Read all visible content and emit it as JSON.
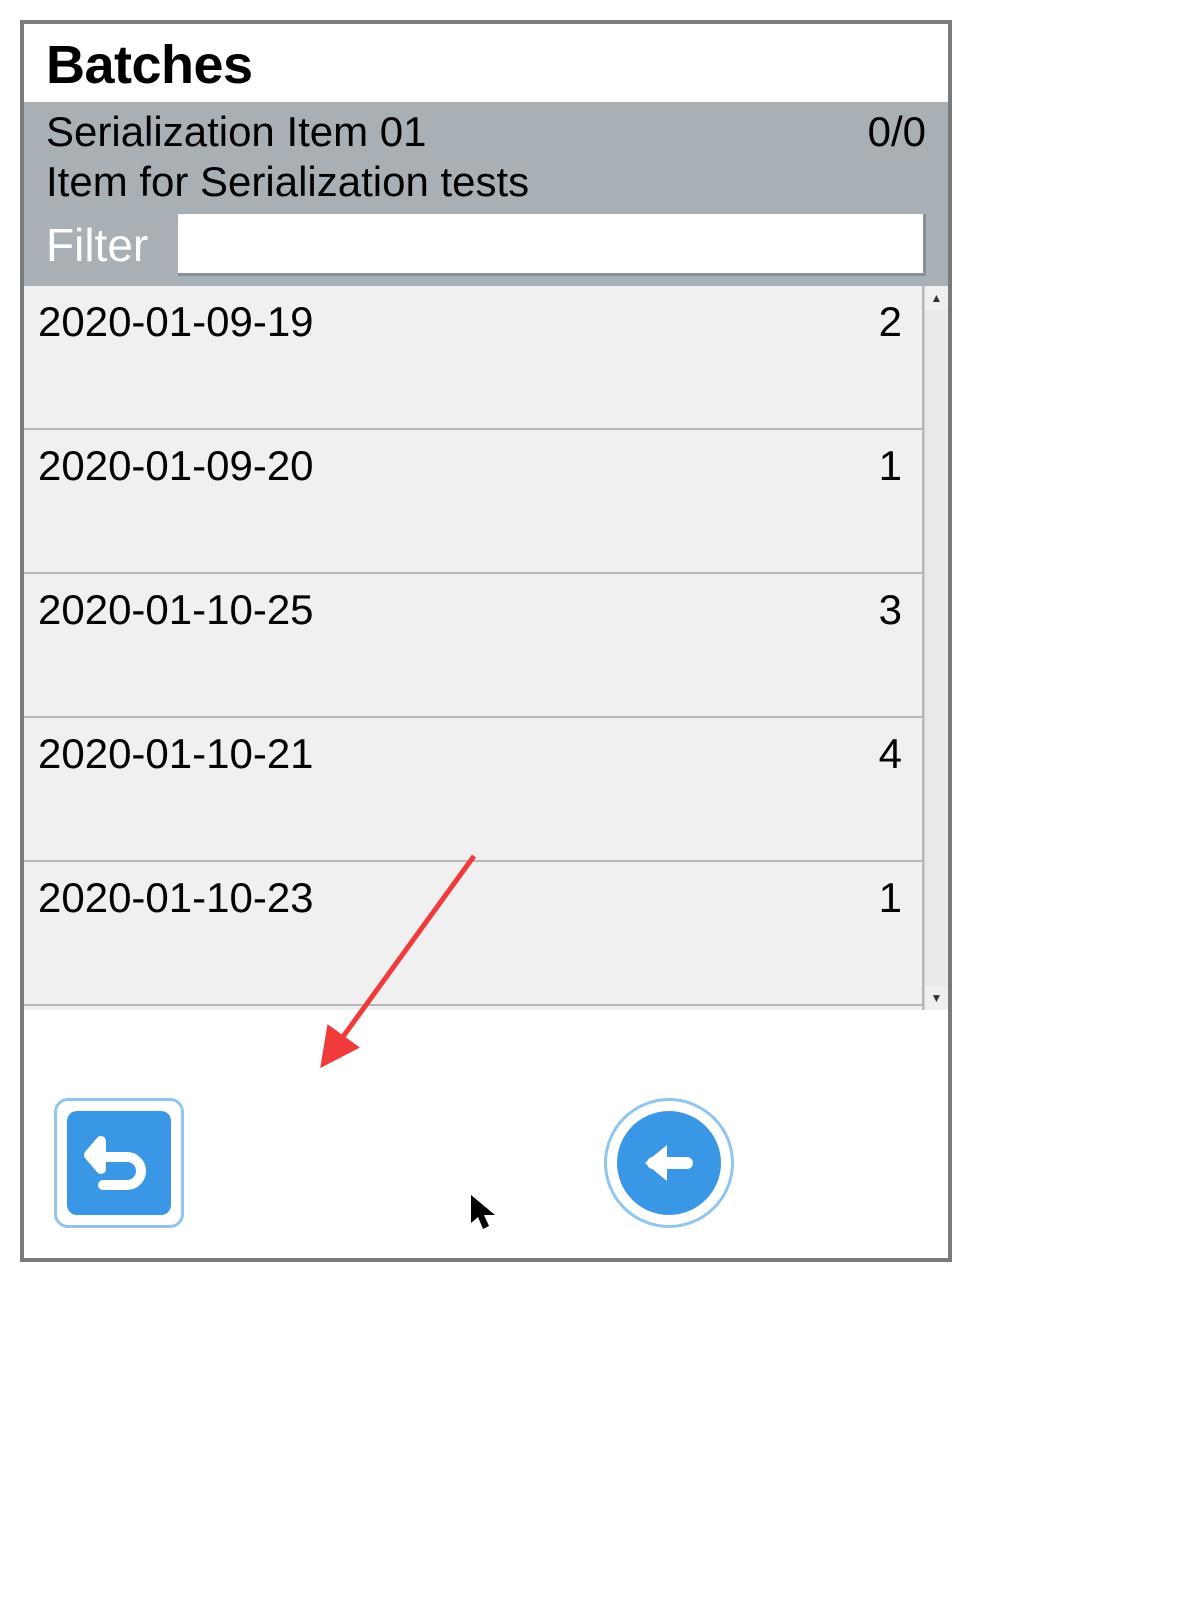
{
  "title": "Batches",
  "info": {
    "item_name": "Serialization Item 01",
    "count": "0/0",
    "item_desc": "Item for Serialization tests"
  },
  "filter": {
    "label": "Filter",
    "value": ""
  },
  "rows": [
    {
      "label": "2020-01-09-19",
      "qty": "2"
    },
    {
      "label": "2020-01-09-20",
      "qty": "1"
    },
    {
      "label": "2020-01-10-25",
      "qty": "3"
    },
    {
      "label": "2020-01-10-21",
      "qty": "4"
    },
    {
      "label": "2020-01-10-23",
      "qty": "1"
    }
  ]
}
